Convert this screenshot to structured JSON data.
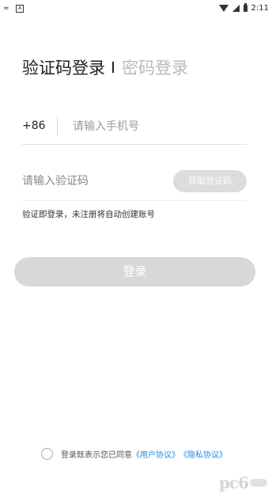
{
  "status_bar": {
    "left_icons": [
      "cat-icon",
      "a-icon"
    ],
    "time": "2:11"
  },
  "tabs": {
    "active": "验证码登录",
    "inactive": "密码登录"
  },
  "phone": {
    "country_code": "+86",
    "placeholder": "请输入手机号",
    "value": ""
  },
  "code": {
    "placeholder": "请输入验证码",
    "value": "",
    "get_code_label": "获取验证码"
  },
  "hint": "验证即登录，未注册将自动创建账号",
  "login_label": "登录",
  "agreement": {
    "prefix": "登录既表示您已同意",
    "user_agreement": "《用户协议》",
    "privacy_agreement": "《隐私协议》"
  },
  "watermark": "pc6",
  "colors": {
    "link": "#1e88e5",
    "disabled_button": "#d8d8d8",
    "inactive_tab": "#b9b9b9"
  }
}
